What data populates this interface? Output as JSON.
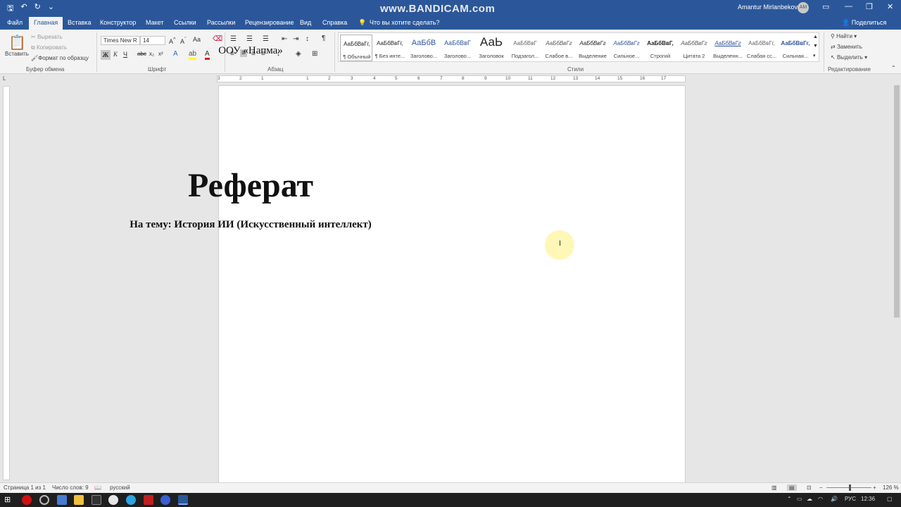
{
  "app": {
    "watermark": "www.BANDICAM.com",
    "user_name": "Amantur Mirlanbekov",
    "user_initials": "AM"
  },
  "tabs": [
    "Файл",
    "Главная",
    "Вставка",
    "Конструктор",
    "Макет",
    "Ссылки",
    "Рассылки",
    "Рецензирование",
    "Вид",
    "Справка"
  ],
  "tell_me": "Что вы хотите сделать?",
  "share": "Поделиться",
  "clipboard": {
    "paste": "Вставить",
    "cut": "Вырезать",
    "copy": "Копировать",
    "format_painter": "Формат по образцу",
    "label": "Буфер обмена"
  },
  "font": {
    "name": "Times New R",
    "size": "14",
    "label": "Шрифт"
  },
  "paragraph": {
    "label": "Абзац"
  },
  "styles": {
    "label": "Стили",
    "items": [
      {
        "preview": "АаБбВвГг,",
        "name": "¶ Обычный"
      },
      {
        "preview": "АаБбВвГг,",
        "name": "¶ Без инте..."
      },
      {
        "preview": "АаБбВ",
        "name": "Заголово..."
      },
      {
        "preview": "АаБбВвГ",
        "name": "Заголово..."
      },
      {
        "preview": "АаЬ",
        "name": "Заголовок"
      },
      {
        "preview": "АаБбВвГ",
        "name": "Подзагол..."
      },
      {
        "preview": "АаБбВвГг",
        "name": "Слабое в..."
      },
      {
        "preview": "АаБбВвГг",
        "name": "Выделение"
      },
      {
        "preview": "АаБбВвГг",
        "name": "Сильное..."
      },
      {
        "preview": "АаБбВвГ,",
        "name": "Строгий"
      },
      {
        "preview": "АаБбВвГг",
        "name": "Цитата 2"
      },
      {
        "preview": "АаБбВвГг",
        "name": "Выделенн..."
      },
      {
        "preview": "АаБбВвГг,",
        "name": "Слабая сс..."
      },
      {
        "preview": "АаБбВвГг,",
        "name": "Сильная..."
      }
    ]
  },
  "editing": {
    "find": "Найти",
    "replace": "Заменить",
    "select": "Выделить",
    "label": "Редактирование"
  },
  "ruler_numbers": [
    "3",
    "2",
    "1",
    "1",
    "2",
    "3",
    "4",
    "5",
    "6",
    "7",
    "8",
    "9",
    "10",
    "11",
    "12",
    "13",
    "14",
    "15",
    "16",
    "17"
  ],
  "document": {
    "org": "ООУ «Напма»",
    "title": "Реферат",
    "subtitle": "На тему: История ИИ (Искусственный интеллект)"
  },
  "status": {
    "page": "Страница 1 из 1",
    "words": "Число слов: 9",
    "lang": "русский",
    "zoom": "126 %"
  },
  "taskbar": {
    "lang": "РУС",
    "time": "12:36"
  }
}
